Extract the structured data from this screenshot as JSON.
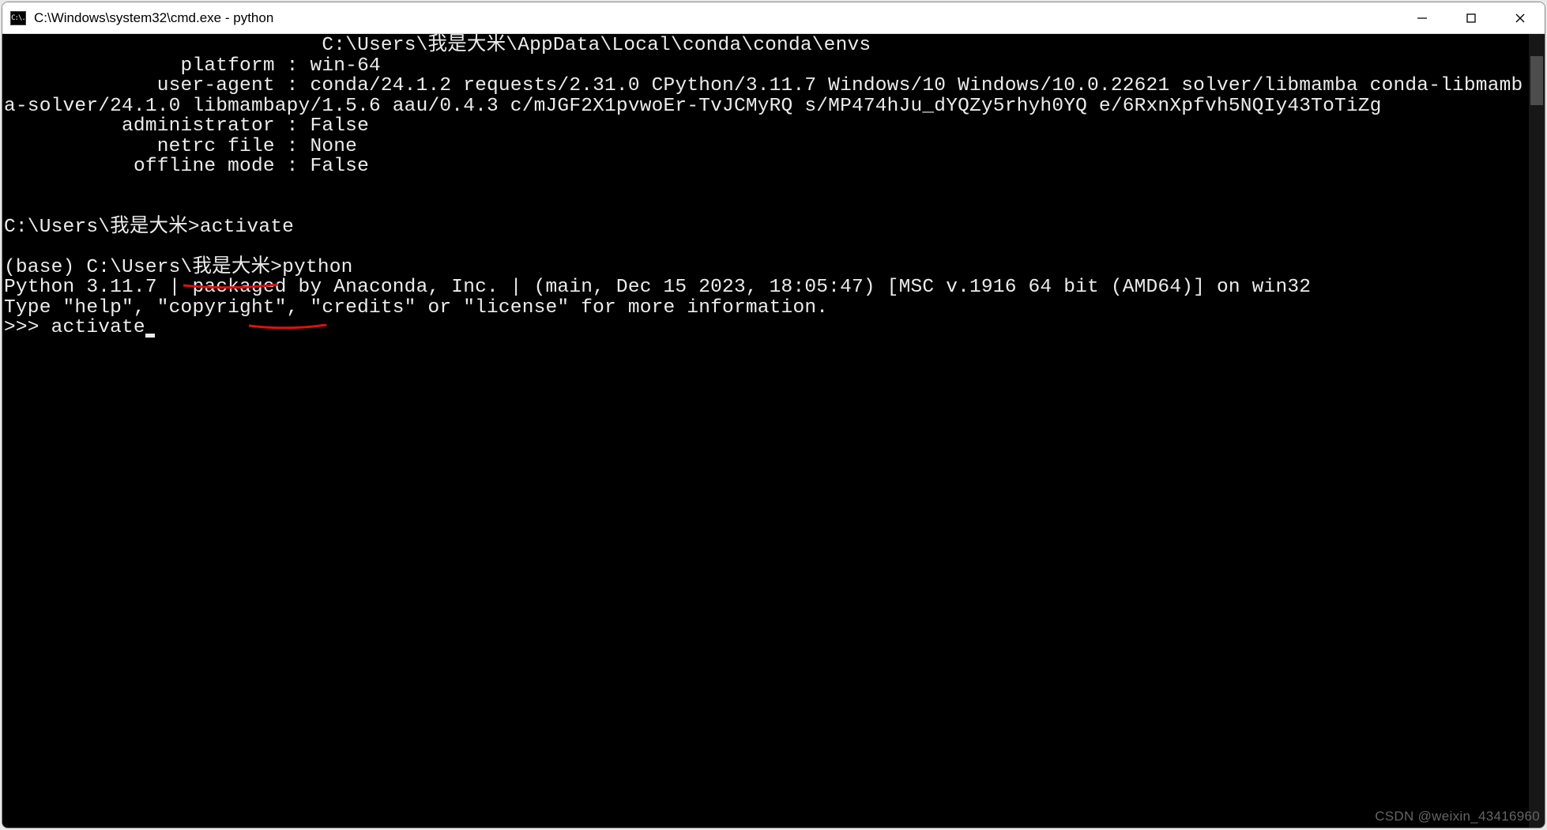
{
  "window": {
    "icon_text": "C:\\.",
    "title": "C:\\Windows\\system32\\cmd.exe - python"
  },
  "terminal": {
    "lines": [
      "                           C:\\Users\\我是大米\\AppData\\Local\\conda\\conda\\envs",
      "               platform : win-64",
      "             user-agent : conda/24.1.2 requests/2.31.0 CPython/3.11.7 Windows/10 Windows/10.0.22621 solver/libmamba conda-libmamba-solver/24.1.0 libmambapy/1.5.6 aau/0.4.3 c/mJGF2X1pvwoEr-TvJCMyRQ s/MP474hJu_dYQZy5rhyh0YQ e/6RxnXpfvh5NQIy43ToTiZg",
      "          administrator : False",
      "             netrc file : None",
      "           offline mode : False",
      "",
      "",
      "C:\\Users\\我是大米>activate",
      "",
      "(base) C:\\Users\\我是大米>python",
      "Python 3.11.7 | packaged by Anaconda, Inc. | (main, Dec 15 2023, 18:05:47) [MSC v.1916 64 bit (AMD64)] on win32",
      "Type \"help\", \"copyright\", \"credits\" or \"license\" for more information.",
      ">>> activate"
    ]
  },
  "watermark": "CSDN @weixin_43416960"
}
